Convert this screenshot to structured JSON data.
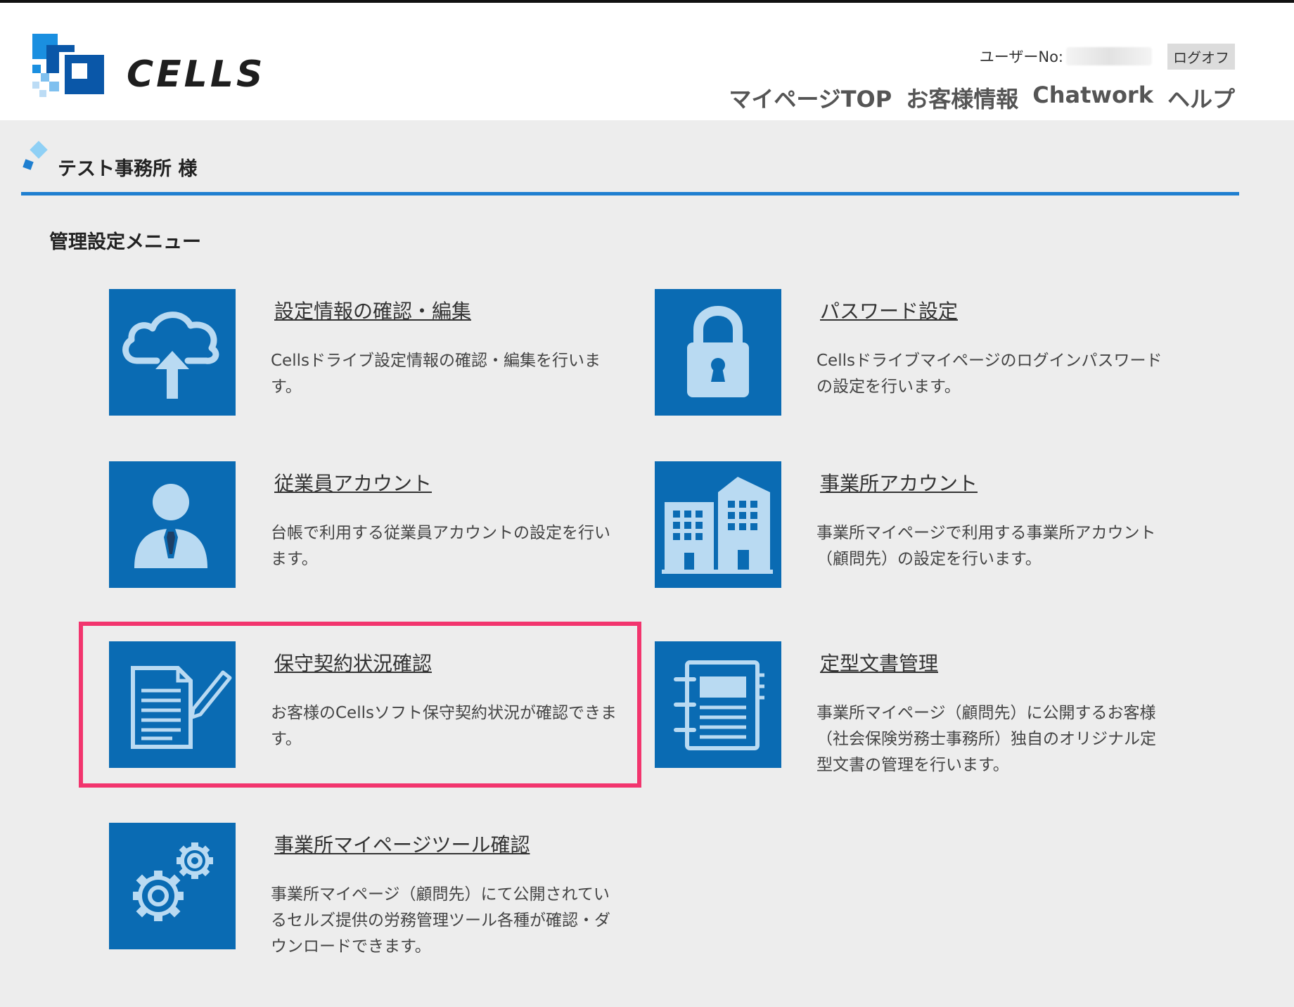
{
  "header": {
    "logo_text": "CELLS",
    "user_label": "ユーザーNo:",
    "logoff_label": "ログオフ",
    "nav": [
      "マイページTOP",
      "お客様情報",
      "Chatwork",
      "ヘルプ"
    ]
  },
  "office": {
    "name": "テスト事務所 様"
  },
  "section_title": "管理設定メニュー",
  "menu": [
    {
      "title": "設定情報の確認・編集",
      "desc": "Cellsドライブ設定情報の確認・編集を行います。",
      "icon": "cloud-upload-icon"
    },
    {
      "title": "パスワード設定",
      "desc": "Cellsドライブマイページのログインパスワードの設定を行います。",
      "icon": "lock-icon"
    },
    {
      "title": "従業員アカウント",
      "desc": "台帳で利用する従業員アカウントの設定を行います。",
      "icon": "employee-icon"
    },
    {
      "title": "事業所アカウント",
      "desc": "事業所マイページで利用する事業所アカウント（顧問先）の設定を行います。",
      "icon": "building-icon"
    },
    {
      "title": "保守契約状況確認",
      "desc": "お客様のCellsソフト保守契約状況が確認できます。",
      "icon": "document-pen-icon"
    },
    {
      "title": "定型文書管理",
      "desc": "事業所マイページ（顧問先）に公開するお客様（社会保険労務士事務所）独自のオリジナル定型文書の管理を行います。",
      "icon": "notebook-icon"
    },
    {
      "title": "事業所マイページツール確認",
      "desc": "事業所マイページ（顧問先）にて公開されているセルズ提供の労務管理ツール各種が確認・ダウンロードできます。",
      "icon": "gears-icon"
    }
  ],
  "colors": {
    "tile": "#0a6bb3",
    "icon": "#b9daf2",
    "accent_line": "#1f7fd0",
    "highlight": "#f2356e"
  }
}
